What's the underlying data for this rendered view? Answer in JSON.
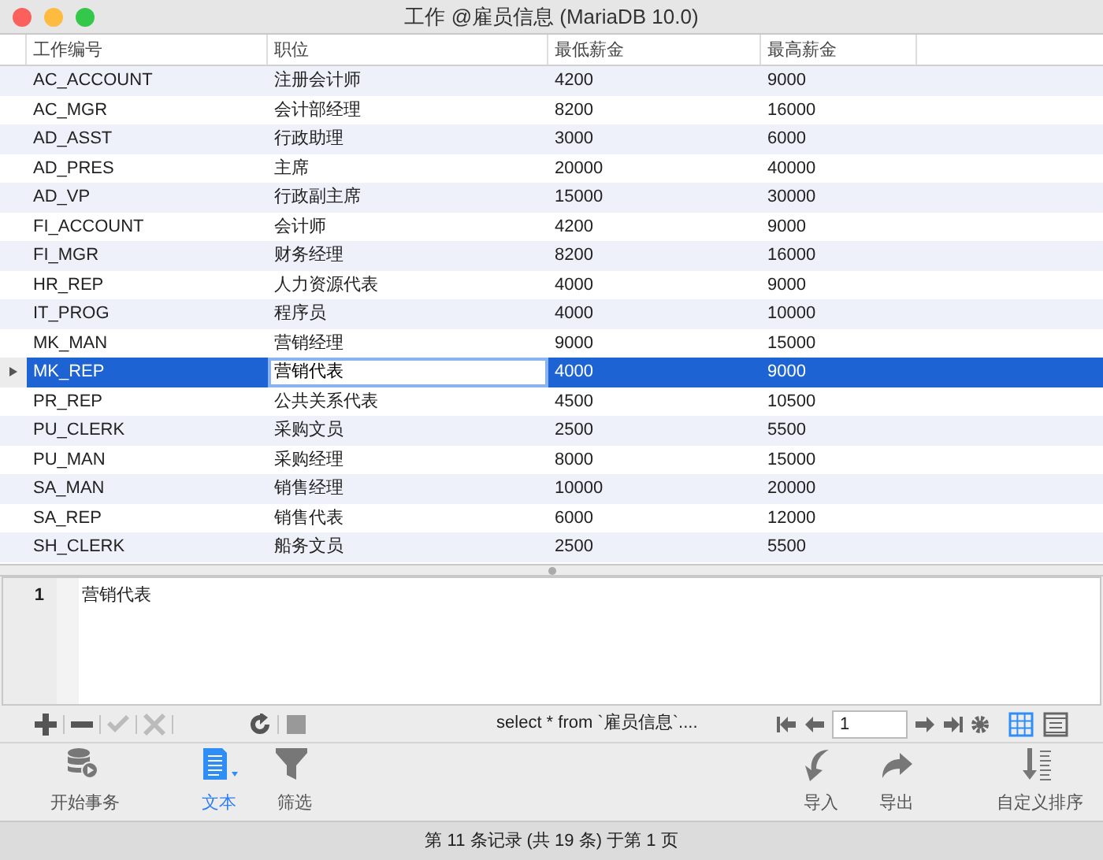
{
  "window": {
    "title": "工作 @雇员信息 (MariaDB 10.0)"
  },
  "table": {
    "columns": [
      "工作编号",
      "职位",
      "最低薪金",
      "最高薪金"
    ],
    "rows": [
      {
        "cells": [
          "AC_ACCOUNT",
          "注册会计师",
          "4200",
          "9000"
        ],
        "selected": false
      },
      {
        "cells": [
          "AC_MGR",
          "会计部经理",
          "8200",
          "16000"
        ],
        "selected": false
      },
      {
        "cells": [
          "AD_ASST",
          "行政助理",
          "3000",
          "6000"
        ],
        "selected": false
      },
      {
        "cells": [
          "AD_PRES",
          "主席",
          "20000",
          "40000"
        ],
        "selected": false
      },
      {
        "cells": [
          "AD_VP",
          "行政副主席",
          "15000",
          "30000"
        ],
        "selected": false
      },
      {
        "cells": [
          "FI_ACCOUNT",
          "会计师",
          "4200",
          "9000"
        ],
        "selected": false
      },
      {
        "cells": [
          "FI_MGR",
          "财务经理",
          "8200",
          "16000"
        ],
        "selected": false
      },
      {
        "cells": [
          "HR_REP",
          "人力资源代表",
          "4000",
          "9000"
        ],
        "selected": false
      },
      {
        "cells": [
          "IT_PROG",
          "程序员",
          "4000",
          "10000"
        ],
        "selected": false
      },
      {
        "cells": [
          "MK_MAN",
          "营销经理",
          "9000",
          "15000"
        ],
        "selected": false
      },
      {
        "cells": [
          "MK_REP",
          "营销代表",
          "4000",
          "9000"
        ],
        "selected": true
      },
      {
        "cells": [
          "PR_REP",
          "公共关系代表",
          "4500",
          "10500"
        ],
        "selected": false
      },
      {
        "cells": [
          "PU_CLERK",
          "采购文员",
          "2500",
          "5500"
        ],
        "selected": false
      },
      {
        "cells": [
          "PU_MAN",
          "采购经理",
          "8000",
          "15000"
        ],
        "selected": false
      },
      {
        "cells": [
          "SA_MAN",
          "销售经理",
          "10000",
          "20000"
        ],
        "selected": false
      },
      {
        "cells": [
          "SA_REP",
          "销售代表",
          "6000",
          "12000"
        ],
        "selected": false
      },
      {
        "cells": [
          "SH_CLERK",
          "船务文员",
          "2500",
          "5500"
        ],
        "selected": false
      }
    ]
  },
  "editor": {
    "line_number": "1",
    "text": "营销代表"
  },
  "edit_toolbar": {
    "buttons": [
      {
        "kind": "add",
        "disabled": false
      },
      {
        "kind": "remove",
        "disabled": false
      },
      {
        "kind": "apply",
        "disabled": true
      },
      {
        "kind": "discard",
        "disabled": true
      },
      {
        "kind": "refresh",
        "disabled": false
      },
      {
        "kind": "stop",
        "disabled": false
      }
    ],
    "query": "select * from `雇员信息`....",
    "page": "1",
    "views": [
      {
        "kind": "grid",
        "selected": true
      },
      {
        "kind": "form",
        "selected": false
      }
    ]
  },
  "main_toolbar": [
    {
      "kind": "transaction",
      "label": "开始事务",
      "selected": false
    },
    {
      "kind": "text",
      "label": "文本",
      "selected": true
    },
    {
      "kind": "filter",
      "label": "筛选",
      "selected": false
    },
    {
      "kind": "import",
      "label": "导入",
      "selected": false
    },
    {
      "kind": "export",
      "label": "导出",
      "selected": false
    },
    {
      "kind": "sort",
      "label": "自定义排序",
      "selected": false
    }
  ],
  "status_bar": "第 11 条记录 (共 19 条) 于第 1 页"
}
